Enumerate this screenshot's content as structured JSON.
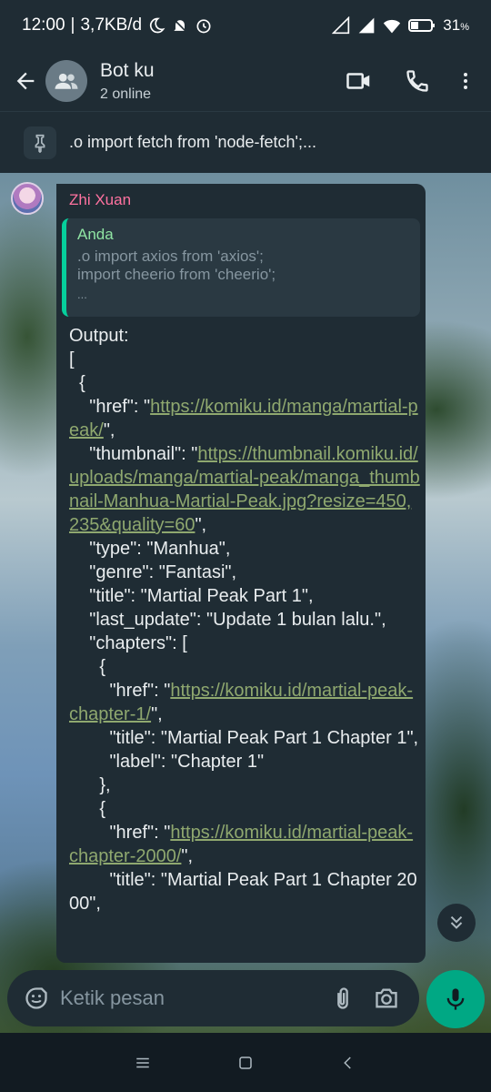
{
  "status_bar": {
    "time": "12:00",
    "net_speed": "3,7KB/d",
    "battery": "31",
    "battery_unit": "%"
  },
  "header": {
    "title": "Bot ku",
    "subtitle": "2 online",
    "icons": [
      "back-arrow-icon",
      "group-avatar-icon",
      "video-call-icon",
      "phone-icon",
      "more-vert-icon"
    ]
  },
  "pinned": {
    "text": ".o import fetch from 'node-fetch';..."
  },
  "message": {
    "sender": "Zhi Xuan",
    "quote": {
      "author": "Anda",
      "line1": ".o import axios from 'axios';",
      "line2": "import cheerio from 'cheerio';",
      "more": "..."
    },
    "lines": [
      "Output:",
      "[",
      "  {",
      "    \"href\": \"",
      "https://komiku.id/manga/martial-peak/",
      "\",",
      "    \"thumbnail\": \"",
      "https://thumbnail.komiku.id/uploads/manga/martial-peak/manga_thumbnail-Manhua-Martial-Peak.jpg?resize=450,235&quality=60",
      "\",",
      "    \"type\": \"Manhua\",",
      "    \"genre\": \"Fantasi\",",
      "    \"title\": \"Martial Peak Part 1\",",
      "    \"last_update\": \"Update 1 bulan lalu.\",",
      "    \"chapters\": [",
      "      {",
      "        \"href\": \"",
      "https://komiku.id/martial-peak-chapter-1/",
      "\",",
      "        \"title\": \"Martial Peak Part 1 Chapter 1\",",
      "        \"label\": \"Chapter 1\"",
      "      },",
      "      {",
      "        \"href\": \"",
      "https://komiku.id/martial-peak-chapter-2000/",
      "\",",
      "        \"title\": \"Martial Peak Part 1 Chapter 2000\","
    ]
  },
  "composer": {
    "placeholder": "Ketik pesan"
  },
  "colors": {
    "header_bg": "#1f2c34",
    "bubble_bg": "#1f2c34",
    "accent": "#00a884",
    "sender": "#ff72a0",
    "quote_author": "#8fe4a3",
    "link": "#8fa86f"
  }
}
